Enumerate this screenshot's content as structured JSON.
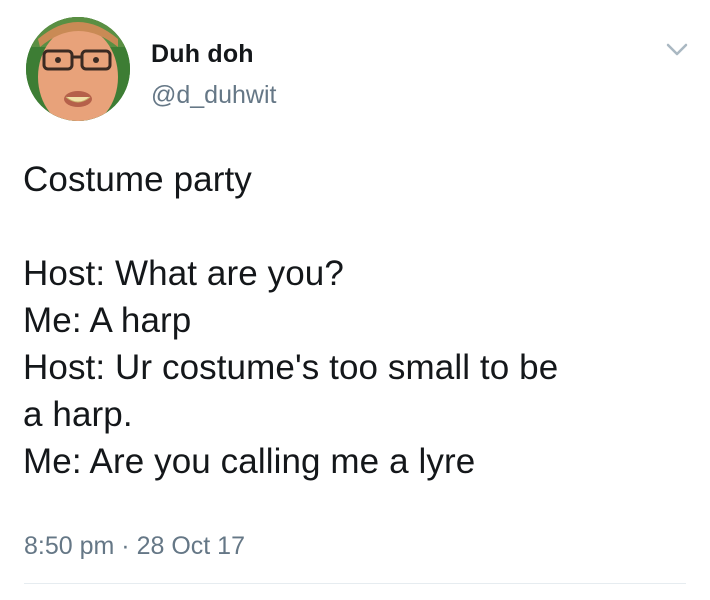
{
  "author": {
    "display_name": "Duh doh",
    "handle": "@d_duhwit",
    "avatar_icon": "profile-photo"
  },
  "menu": {
    "icon": "chevron-down-icon"
  },
  "tweet": {
    "lines": [
      "Costume party",
      "",
      "Host: What are you?",
      "Me: A harp",
      "Host: Ur costume's too small to be",
      "a harp.",
      "Me: Are you calling me a lyre"
    ]
  },
  "meta": {
    "time": "8:50 pm",
    "separator": "·",
    "date": "28 Oct 17"
  },
  "colors": {
    "text": "#14171a",
    "secondary": "#657786",
    "divider": "#e6ecf0"
  }
}
